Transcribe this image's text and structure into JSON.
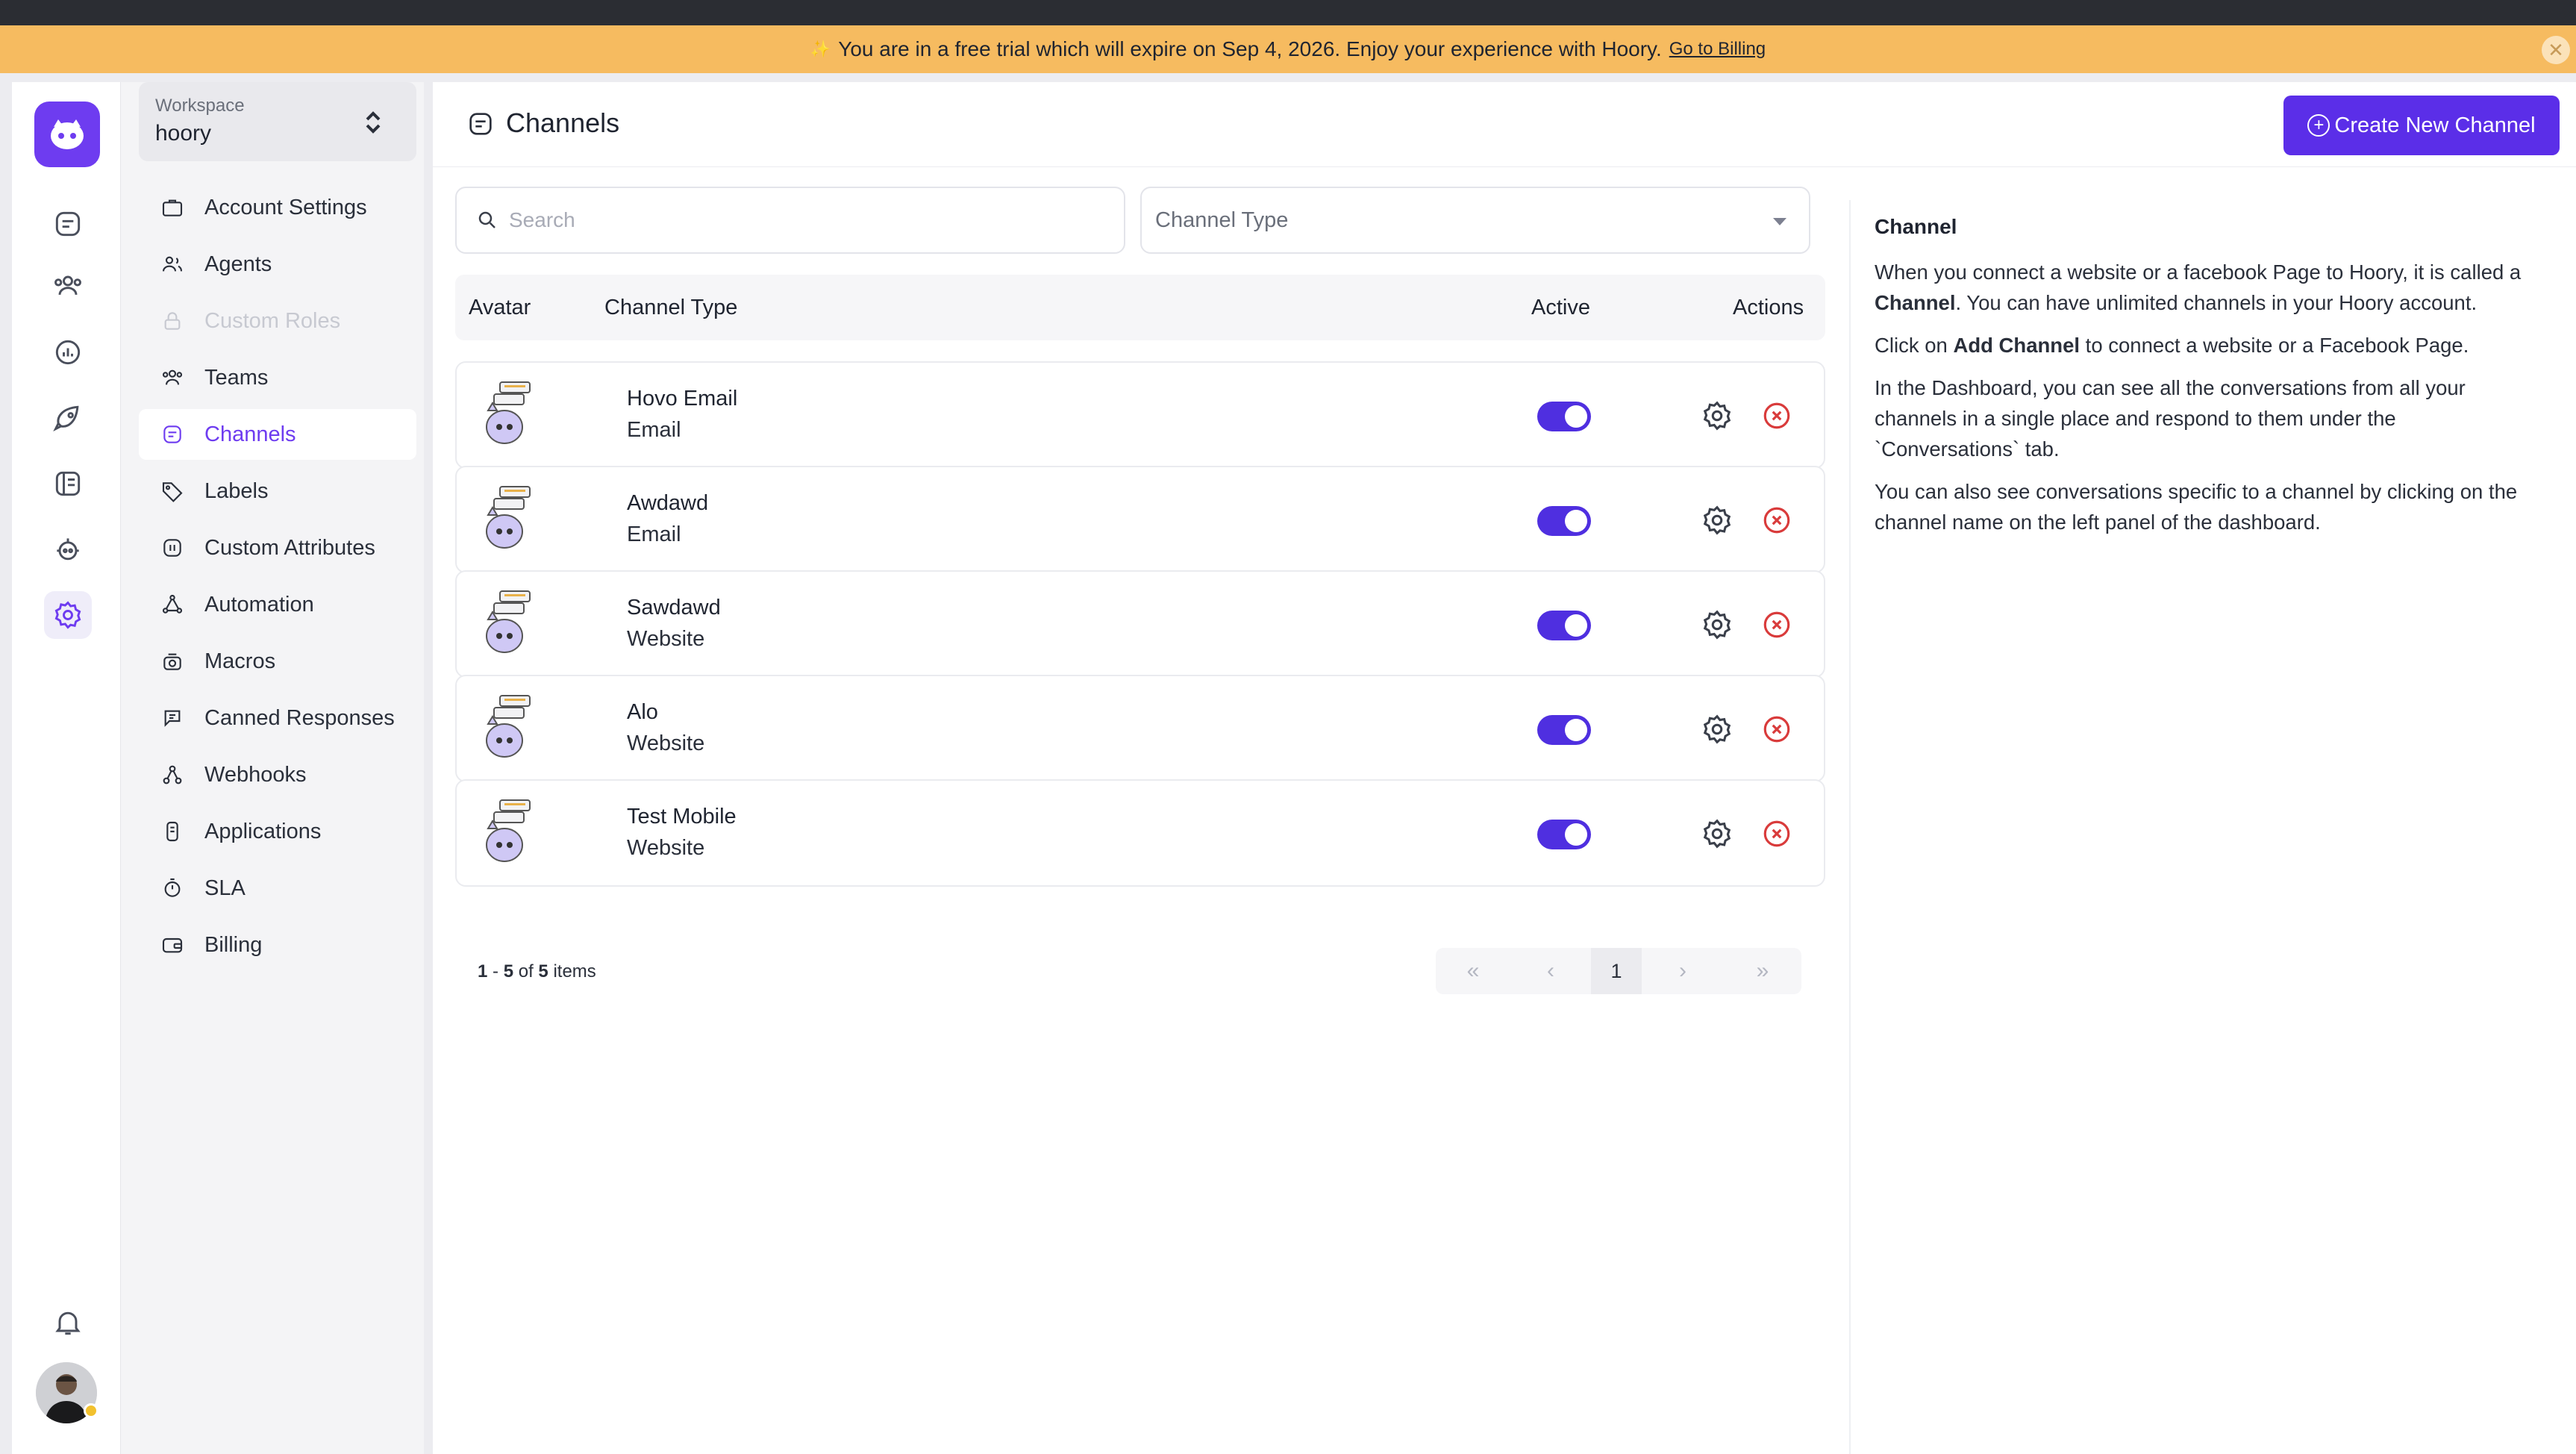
{
  "banner": {
    "text": "You are in a free trial which will expire on Sep 4, 2026. Enjoy your experience with Hoory.",
    "link": "Go to Billing"
  },
  "workspace": {
    "label": "Workspace",
    "value": "hoory"
  },
  "nav": [
    {
      "label": "Account Settings",
      "icon": "briefcase-icon",
      "state": "normal"
    },
    {
      "label": "Agents",
      "icon": "users-icon",
      "state": "normal"
    },
    {
      "label": "Custom Roles",
      "icon": "lock-icon",
      "state": "disabled"
    },
    {
      "label": "Teams",
      "icon": "team-icon",
      "state": "normal"
    },
    {
      "label": "Channels",
      "icon": "channels-icon",
      "state": "active"
    },
    {
      "label": "Labels",
      "icon": "tag-icon",
      "state": "normal"
    },
    {
      "label": "Custom Attributes",
      "icon": "attribute-icon",
      "state": "normal"
    },
    {
      "label": "Automation",
      "icon": "automation-icon",
      "state": "normal"
    },
    {
      "label": "Macros",
      "icon": "macros-icon",
      "state": "normal"
    },
    {
      "label": "Canned Responses",
      "icon": "canned-icon",
      "state": "normal"
    },
    {
      "label": "Webhooks",
      "icon": "webhook-icon",
      "state": "normal"
    },
    {
      "label": "Applications",
      "icon": "applications-icon",
      "state": "normal"
    },
    {
      "label": "SLA",
      "icon": "stopwatch-icon",
      "state": "normal"
    },
    {
      "label": "Billing",
      "icon": "wallet-icon",
      "state": "normal"
    }
  ],
  "page": {
    "title": "Channels",
    "create_label": "Create New Channel"
  },
  "filters": {
    "search_placeholder": "Search",
    "channel_type_placeholder": "Channel Type"
  },
  "table": {
    "headers": {
      "avatar": "Avatar",
      "channel_type": "Channel Type",
      "active": "Active",
      "actions": "Actions"
    },
    "rows": [
      {
        "name": "Hovo Email",
        "type": "Email",
        "active": true
      },
      {
        "name": "Awdawd",
        "type": "Email",
        "active": true
      },
      {
        "name": "Sawdawd",
        "type": "Website",
        "active": true
      },
      {
        "name": "Alo",
        "type": "Website",
        "active": true
      },
      {
        "name": "Test Mobile",
        "type": "Website",
        "active": true
      }
    ]
  },
  "pagination": {
    "from": "1",
    "to": "5",
    "of_label": "of",
    "total": "5",
    "items_label": "items",
    "current_page": "1"
  },
  "info": {
    "title": "Channel",
    "p1_pre": "When you connect a website or a facebook Page to Hoory, it is called a ",
    "p1_bold": "Channel",
    "p1_post": ". You can have unlimited channels in your Hoory account.",
    "p2_pre": "Click on ",
    "p2_bold": "Add Channel",
    "p2_post": " to connect a website or a Facebook Page.",
    "p3": "In the Dashboard, you can see all the conversations from all your channels in a single place and respond to them under the `Conversations` tab.",
    "p4": "You can also see conversations specific to a channel by clicking on the channel name on the left panel of the dashboard."
  },
  "colors": {
    "accent": "#5b2ee8",
    "toggle_on": "#4f2fe0",
    "banner": "#f6bb60",
    "danger": "#d93b3b"
  }
}
